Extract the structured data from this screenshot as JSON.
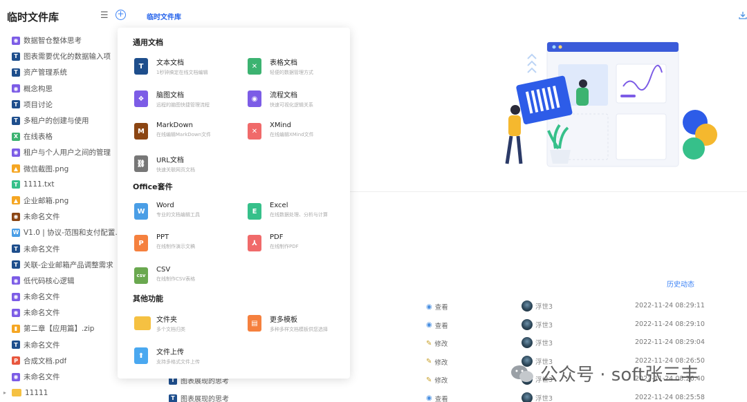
{
  "sidebar": {
    "title": "临时文件库",
    "items": [
      {
        "label": "数据智仓整体思考",
        "type": "M",
        "color": "#7c5ce6"
      },
      {
        "label": "图表需要优化的数据输入项",
        "type": "T",
        "color": "#1e4e8c"
      },
      {
        "label": "资产管理系统",
        "type": "T",
        "color": "#1e4e8c"
      },
      {
        "label": "概念构思",
        "type": "M",
        "color": "#7c5ce6"
      },
      {
        "label": "项目讨论",
        "type": "T",
        "color": "#1e4e8c"
      },
      {
        "label": "多租户的创建与使用",
        "type": "T",
        "color": "#1e4e8c"
      },
      {
        "label": "在线表格",
        "type": "X",
        "color": "#3cb371"
      },
      {
        "label": "租户与个人用户之间的管理",
        "type": "M",
        "color": "#7c5ce6"
      },
      {
        "label": "微信截图.png",
        "type": "I",
        "color": "#f5a623"
      },
      {
        "label": "1111.txt",
        "type": "T",
        "color": "#36c08a"
      },
      {
        "label": "企业邮箱.png",
        "type": "I",
        "color": "#f5a623"
      },
      {
        "label": "未命名文件",
        "type": "M",
        "color": "#8b4513"
      },
      {
        "label": "V1.0 | 协议-范围和支付配置协...",
        "type": "W",
        "color": "#4a9ee6"
      },
      {
        "label": "未命名文件",
        "type": "T",
        "color": "#1e4e8c"
      },
      {
        "label": "关联-企业邮箱产品调整需求",
        "type": "T",
        "color": "#1e4e8c"
      },
      {
        "label": "低代码核心逻辑",
        "type": "M",
        "color": "#7c5ce6"
      },
      {
        "label": "未命名文件",
        "type": "M",
        "color": "#7c5ce6"
      },
      {
        "label": "未命名文件",
        "type": "M",
        "color": "#7c5ce6"
      },
      {
        "label": "第二章【应用篇】.zip",
        "type": "Z",
        "color": "#f5a623"
      },
      {
        "label": "未命名文件",
        "type": "T",
        "color": "#1e4e8c"
      },
      {
        "label": "合成文档.pdf",
        "type": "P",
        "color": "#e8573e"
      },
      {
        "label": "未命名文件",
        "type": "M",
        "color": "#7c5ce6"
      },
      {
        "label": "11111",
        "type": "F",
        "color": "#f5c142"
      }
    ]
  },
  "top": {
    "link": "临时文件库"
  },
  "panel": {
    "section1": "通用文档",
    "section2": "Office套件",
    "section3": "其他功能",
    "options": [
      {
        "title": "文本文档",
        "desc": "1秒钟搞定在线文档编辑",
        "glyph": "T",
        "color": "#1e4e8c"
      },
      {
        "title": "表格文档",
        "desc": "轻便的数据管理方式",
        "glyph": "✕",
        "color": "#3cb371"
      },
      {
        "title": "脑图文档",
        "desc": "远程的脑图快捷管理流程",
        "glyph": "❖",
        "color": "#7c5ce6"
      },
      {
        "title": "流程文档",
        "desc": "快速可视化逻辑关系",
        "glyph": "◉",
        "color": "#7c5ce6"
      },
      {
        "title": "MarkDown",
        "desc": "在线编辑MarkDown文件",
        "glyph": "M",
        "color": "#8b4513"
      },
      {
        "title": "XMind",
        "desc": "在线编辑XMind文件",
        "glyph": "✕",
        "color": "#f06a6a"
      },
      {
        "title": "URL文档",
        "desc": "快速关联网页文档",
        "glyph": "⛓",
        "color": "#777"
      },
      {
        "title": "Word",
        "desc": "专业的文档编辑工具",
        "glyph": "W",
        "color": "#4a9ee6"
      },
      {
        "title": "Excel",
        "desc": "在线数据处理、分析与计算",
        "glyph": "E",
        "color": "#36c08a"
      },
      {
        "title": "PPT",
        "desc": "在线制作演示文稿",
        "glyph": "P",
        "color": "#f5803e"
      },
      {
        "title": "PDF",
        "desc": "在线制作PDF",
        "glyph": "⅄",
        "color": "#f06a6a"
      },
      {
        "title": "CSV",
        "desc": "在线制作CSV表格",
        "glyph": "csv",
        "color": "#6aa84f"
      },
      {
        "title": "文件夹",
        "desc": "多个文档归类",
        "glyph": "",
        "color": "#f5c142"
      },
      {
        "title": "更多模板",
        "desc": "多种多样文档模板供您选择",
        "glyph": "▤",
        "color": "#f5803e"
      },
      {
        "title": "文件上传",
        "desc": "支持多格式文件上传",
        "glyph": "⬆",
        "color": "#4aa8f0"
      }
    ]
  },
  "history": {
    "link": "历史动态",
    "rows": [
      {
        "action": "查看",
        "icon": "eye-icon",
        "user": "浮世3",
        "time": "2022-11-24 08:29:11"
      },
      {
        "action": "查看",
        "icon": "eye-icon",
        "user": "浮世3",
        "time": "2022-11-24 08:29:10"
      },
      {
        "action": "修改",
        "icon": "pencil-icon",
        "user": "浮世3",
        "time": "2022-11-24 08:29:04"
      },
      {
        "action": "修改",
        "icon": "pencil-icon",
        "user": "浮世3",
        "time": "2022-11-24 08:26:50"
      },
      {
        "action": "修改",
        "icon": "pencil-icon",
        "user": "浮世3",
        "time": "2022-11-24 08:26:40"
      },
      {
        "action": "查看",
        "icon": "eye-icon",
        "user": "浮世3",
        "time": "2022-11-24 08:25:58"
      }
    ],
    "doc_rows": [
      "图表展现的思考",
      "图表展现的思考"
    ]
  },
  "watermark": "公众号 · soft张三丰"
}
